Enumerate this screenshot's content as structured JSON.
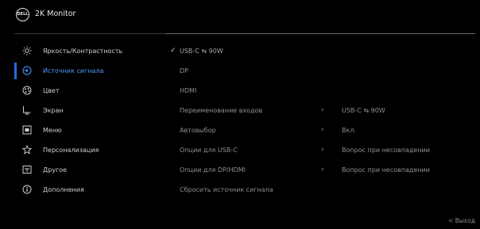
{
  "header": {
    "logo_text": "DELL",
    "title": "2K Monitor"
  },
  "menu": [
    {
      "icon": "brightness-icon",
      "label": "Яркость/Контрастность",
      "active": false
    },
    {
      "icon": "input-source-icon",
      "label": "Источник сигнала",
      "active": true
    },
    {
      "icon": "color-icon",
      "label": "Цвет",
      "active": false
    },
    {
      "icon": "display-icon",
      "label": "Экран",
      "active": false
    },
    {
      "icon": "menu-icon",
      "label": "Меню",
      "active": false
    },
    {
      "icon": "star-icon",
      "label": "Персонализация",
      "active": false
    },
    {
      "icon": "others-icon",
      "label": "Другое",
      "active": false
    },
    {
      "icon": "info-icon",
      "label": "Дополнения",
      "active": false
    }
  ],
  "submenu": [
    {
      "text": "USB-C ⇆ 90W",
      "checked": true,
      "arrow": false
    },
    {
      "text": "DP",
      "checked": false,
      "arrow": false
    },
    {
      "text": "HDMI",
      "checked": false,
      "arrow": false
    },
    {
      "text": "Переименование входов",
      "checked": false,
      "arrow": true
    },
    {
      "text": "Автовыбор",
      "checked": false,
      "arrow": true
    },
    {
      "text": "Опции для USB-C",
      "checked": false,
      "arrow": true
    },
    {
      "text": "Опции для DP/HDMI",
      "checked": false,
      "arrow": true
    },
    {
      "text": "Сбросить источник сигнала",
      "checked": false,
      "arrow": false
    }
  ],
  "values": [
    "",
    "",
    "",
    "USB-C ⇆ 90W",
    "Вкл.",
    "Вопрос при несовпадении",
    "Вопрос при несовпадении",
    ""
  ],
  "footer": {
    "back_label": "< Выход"
  },
  "colors": {
    "accent": "#1f6fe0",
    "accent_text": "#4d9bff",
    "background": "#000000"
  }
}
